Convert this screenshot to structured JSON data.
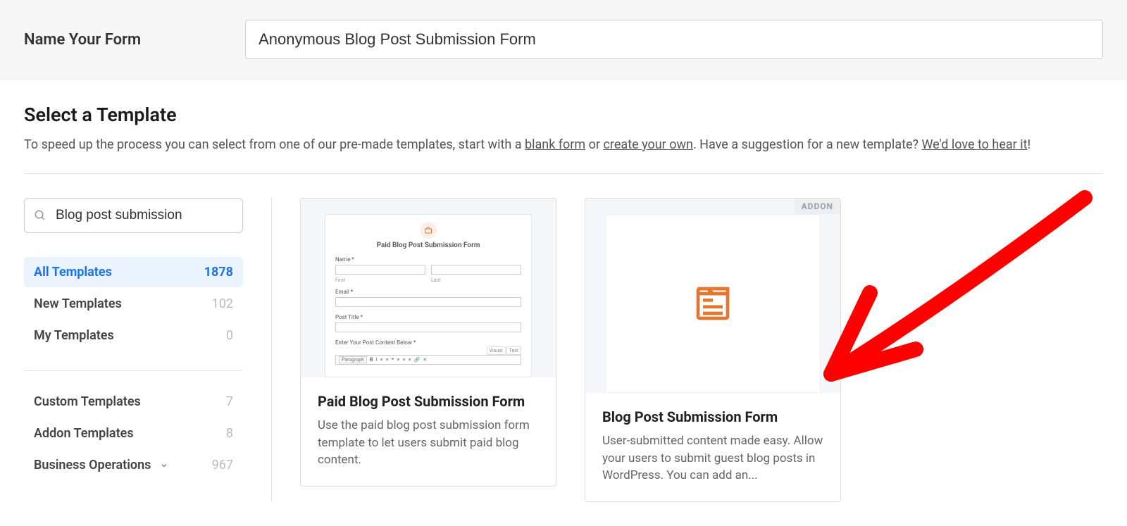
{
  "top": {
    "label": "Name Your Form",
    "input_value": "Anonymous Blog Post Submission Form"
  },
  "select": {
    "heading": "Select a Template",
    "subtitle_pre": "To speed up the process you can select from one of our pre-made templates, start with a ",
    "blank_link": "blank form",
    "or": " or ",
    "create_link": "create your own",
    "subtitle_mid": ". Have a suggestion for a new template? ",
    "suggest_link": "We'd love to hear it",
    "excl": "!"
  },
  "search": {
    "value": "Blog post submission"
  },
  "categories_top": [
    {
      "label": "All Templates",
      "count": "1878",
      "active": true
    },
    {
      "label": "New Templates",
      "count": "102",
      "active": false
    },
    {
      "label": "My Templates",
      "count": "0",
      "active": false
    }
  ],
  "categories_bottom": [
    {
      "label": "Custom Templates",
      "count": "7"
    },
    {
      "label": "Addon Templates",
      "count": "8"
    },
    {
      "label": "Business Operations",
      "count": "967"
    }
  ],
  "cards": [
    {
      "title": "Paid Blog Post Submission Form",
      "desc": "Use the paid blog post submission form template to let users submit paid blog content.",
      "addon": false,
      "preview": {
        "title": "Paid Blog Post Submission Form",
        "name_label": "Name *",
        "first": "First",
        "last": "Last",
        "email_label": "Email *",
        "post_title_label": "Post Title *",
        "content_label": "Enter Your Post Content Below *",
        "visual": "Visual",
        "text": "Text",
        "paragraph": "Paragraph"
      }
    },
    {
      "title": "Blog Post Submission Form",
      "desc": "User-submitted content made easy. Allow your users to submit guest blog posts in WordPress. You can add an...",
      "addon": true,
      "addon_label": "ADDON"
    }
  ]
}
